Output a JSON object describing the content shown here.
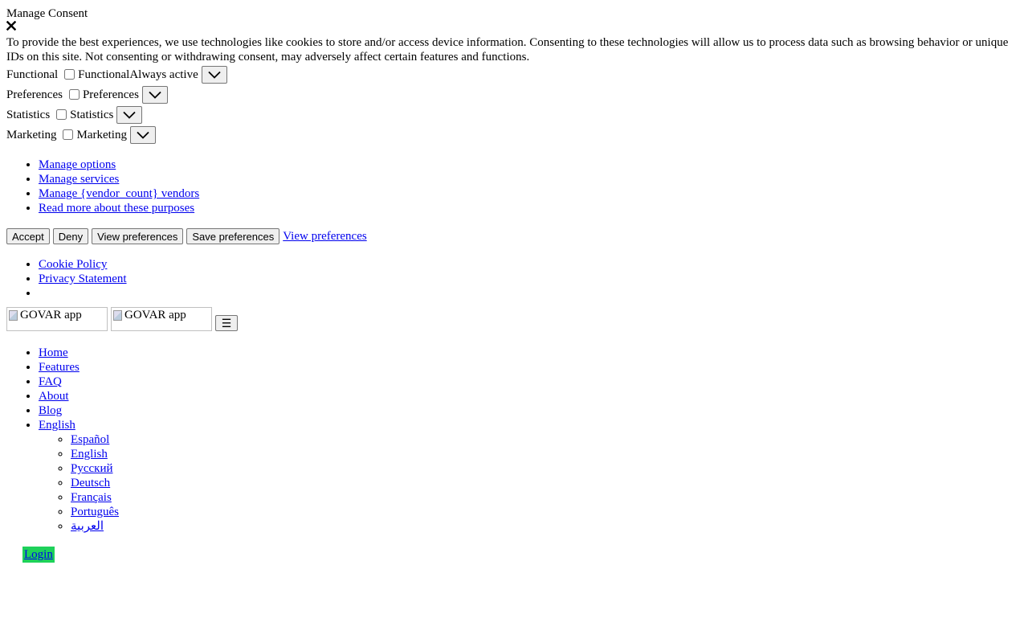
{
  "consent": {
    "title": "Manage Consent",
    "close_icon": "close-icon",
    "description": "To provide the best experiences, we use technologies like cookies to store and/or access device information. Consenting to these technologies will allow us to process data such as browsing behavior or unique IDs on this site. Not consenting or withdrawing consent, may adversely affect certain features and functions.",
    "categories": [
      {
        "label": "Functional",
        "checkbox_label": "Functional",
        "status": "Always active"
      },
      {
        "label": "Preferences",
        "checkbox_label": "Preferences"
      },
      {
        "label": "Statistics",
        "checkbox_label": "Statistics"
      },
      {
        "label": "Marketing",
        "checkbox_label": "Marketing"
      }
    ],
    "links": [
      "Manage options",
      "Manage services",
      "Manage {vendor_count} vendors",
      "Read more about these purposes"
    ],
    "buttons": {
      "accept": "Accept",
      "deny": "Deny",
      "view_preferences": "View preferences",
      "save_preferences": "Save preferences",
      "view_preferences_link": "View preferences"
    },
    "policy_links": [
      "Cookie Policy",
      "Privacy Statement"
    ]
  },
  "header": {
    "logo_alt": "GOVAR app",
    "logo_alt_2": "GOVAR app",
    "menu_icon": "hamburger-menu-icon",
    "menu_glyph": "☰"
  },
  "nav": {
    "items": [
      "Home",
      "Features",
      "FAQ",
      "About",
      "Blog",
      "English"
    ],
    "languages": [
      "Español",
      "English",
      "Русский",
      "Deutsch",
      "Français",
      "Português",
      "العربية"
    ],
    "login": "Login"
  },
  "colors": {
    "link": "#0000ee",
    "login_bg": "#1ed15a"
  }
}
